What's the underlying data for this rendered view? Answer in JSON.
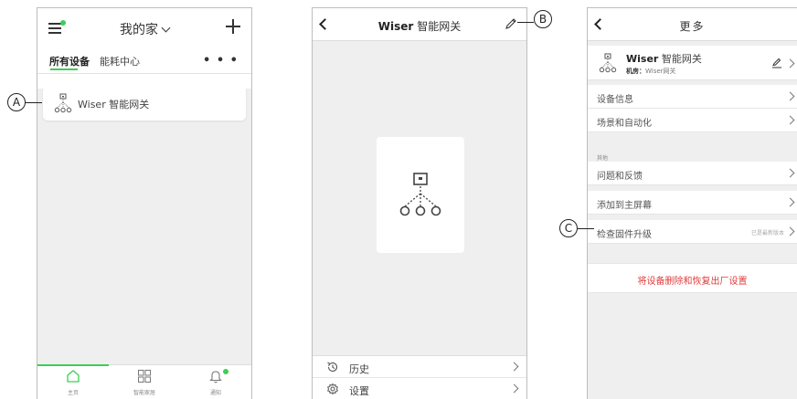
{
  "screens": {
    "home": {
      "home_name": "我的家",
      "tabs": [
        "所有设备",
        "能耗中心"
      ],
      "more": "• • •",
      "device": {
        "name": "Wiser 智能网关"
      },
      "nav": [
        {
          "label": "主页",
          "icon": "home-icon"
        },
        {
          "label": "智能家居",
          "icon": "grid-icon"
        },
        {
          "label": "通知",
          "icon": "bell-icon"
        }
      ]
    },
    "device_detail": {
      "title_brand": "Wiser",
      "title_name": "智能网关",
      "list": [
        {
          "label": "历史",
          "icon": "history-icon"
        },
        {
          "label": "设置",
          "icon": "gear-icon"
        }
      ]
    },
    "more": {
      "title": "更多",
      "device_brand": "Wiser",
      "device_name": "智能网关",
      "room_label": "机房：",
      "room_value": "Wiser网关",
      "rows_top": [
        "设备信息",
        "场景和自动化"
      ],
      "section_label": "其他",
      "rows_other": [
        "问题和反馈",
        "添加到主屏幕",
        "检查固件升级"
      ],
      "firmware_status": "已是最新版本",
      "danger_action": "将设备删除和恢复出厂设置"
    }
  },
  "callouts": [
    "A",
    "B",
    "C"
  ],
  "colors": {
    "accent": "#3dcd58",
    "danger": "#e03b3b"
  }
}
